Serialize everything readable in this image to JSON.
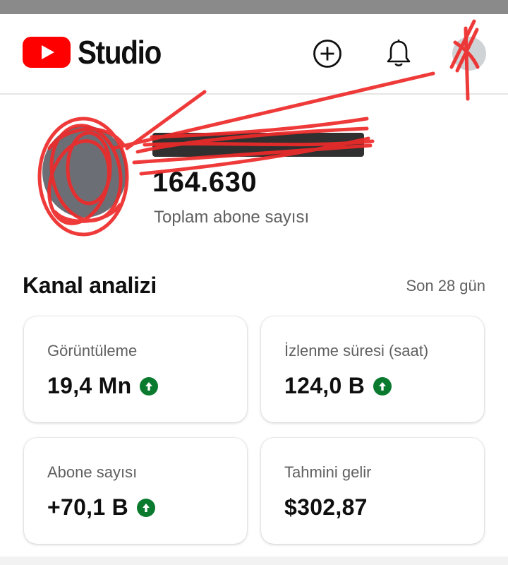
{
  "header": {
    "app_title": "Studio",
    "icons": [
      "youtube-logo",
      "create-add-icon",
      "notifications-bell-icon",
      "account-avatar"
    ]
  },
  "channel": {
    "subscriber_count": "164.630",
    "subscriber_label": "Toplam abone sayısı"
  },
  "analytics": {
    "title": "Kanal analizi",
    "period": "Son 28 gün",
    "cards": [
      {
        "label": "Görüntüleme",
        "value": "19,4 Mn",
        "trend": "up"
      },
      {
        "label": "İzlenme süresi (saat)",
        "value": "124,0 B",
        "trend": "up"
      },
      {
        "label": "Abone sayısı",
        "value": "+70,1 B",
        "trend": "up"
      },
      {
        "label": "Tahmini gelir",
        "value": "$302,87",
        "trend": ""
      }
    ]
  },
  "colors": {
    "brand_red": "#ff0000",
    "trend_up_green": "#0a7b2e",
    "redaction_red": "#ee2a2a",
    "secondary_text": "#606060"
  }
}
